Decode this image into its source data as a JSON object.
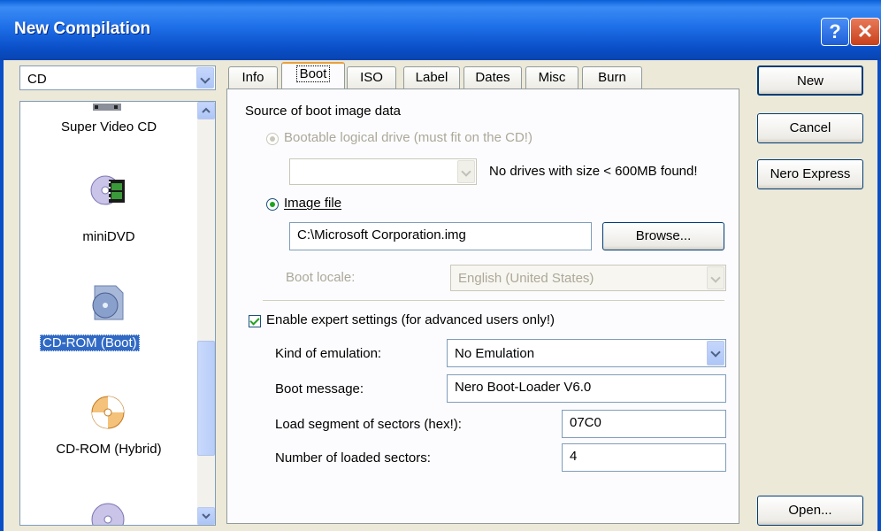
{
  "window": {
    "title": "New Compilation",
    "help_glyph": "?",
    "close_glyph": "✕"
  },
  "disc_type": {
    "selected": "CD"
  },
  "compilation_list": {
    "items": [
      {
        "label": "Super Video CD",
        "icon": "video-disc-icon"
      },
      {
        "label": "miniDVD",
        "icon": "film-disc-icon"
      },
      {
        "label": "CD-ROM (Boot)",
        "icon": "boot-disc-icon",
        "selected": true
      },
      {
        "label": "CD-ROM (Hybrid)",
        "icon": "hybrid-disc-icon"
      },
      {
        "label": "",
        "icon": "disc-icon"
      }
    ]
  },
  "tabs": [
    {
      "label": "Info"
    },
    {
      "label": "Boot",
      "active": true
    },
    {
      "label": "ISO"
    },
    {
      "label": "Label"
    },
    {
      "label": "Dates"
    },
    {
      "label": "Misc"
    },
    {
      "label": "Burn"
    }
  ],
  "boot": {
    "source_heading": "Source of boot image data",
    "bootable_drive_label": "Bootable logical drive (must fit on the CD!)",
    "drive_select_value": "",
    "drive_warning": "No drives with size < 600MB found!",
    "image_file_label": "Image file",
    "image_file_value": "C:\\Microsoft Corporation.img",
    "browse_label": "Browse...",
    "boot_locale_label": "Boot locale:",
    "boot_locale_value": "English (United States)",
    "expert_label": "Enable expert settings (for advanced users only!)",
    "emulation_label": "Kind of emulation:",
    "emulation_value": "No Emulation",
    "boot_message_label": "Boot message:",
    "boot_message_value": "Nero Boot-Loader V6.0",
    "load_segment_label": "Load segment of sectors (hex!):",
    "load_segment_value": "07C0",
    "loaded_sectors_label": "Number of loaded sectors:",
    "loaded_sectors_value": "4"
  },
  "actions": {
    "new": "New",
    "cancel": "Cancel",
    "nero_express": "Nero Express",
    "open": "Open..."
  },
  "colors": {
    "titlebar": "#0a5fd8",
    "face": "#ece9d8",
    "selection": "#316ac5",
    "radio_dot": "#21a121"
  }
}
